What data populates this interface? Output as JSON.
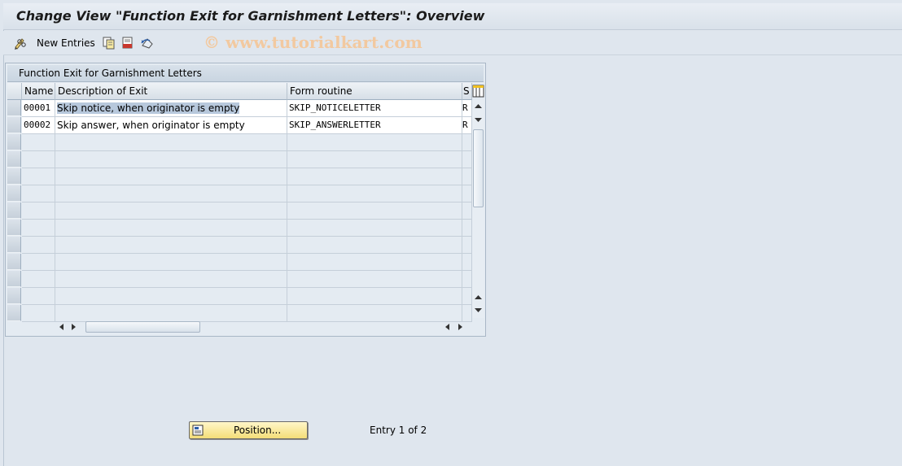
{
  "window": {
    "title": "Change View \"Function Exit for Garnishment Letters\": Overview"
  },
  "toolbar": {
    "new_entries_label": "New Entries",
    "watermark": "© www.tutorialkart.com"
  },
  "panel": {
    "title": "Function Exit for Garnishment Letters"
  },
  "table": {
    "columns": [
      "Name",
      "Description of Exit",
      "Form routine",
      "S"
    ],
    "rows": [
      {
        "name": "00001",
        "description": "Skip notice, when originator is empty",
        "routine": "SKIP_NOTICELETTER",
        "s": "R"
      },
      {
        "name": "00002",
        "description": "Skip answer, when originator is empty",
        "routine": "SKIP_ANSWERLETTER",
        "s": "R"
      }
    ]
  },
  "footer": {
    "position_button": "Position...",
    "entry_status": "Entry 1 of 2"
  },
  "colors": {
    "background": "#dfe6ee",
    "button_yellow": "#f4dd78",
    "selection_highlight": "#b7c8dc"
  }
}
